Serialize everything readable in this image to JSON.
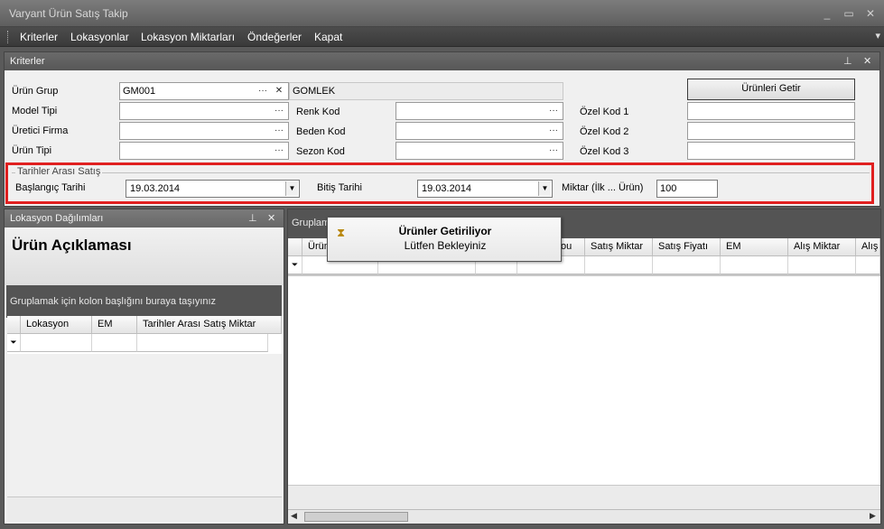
{
  "window": {
    "title": "Varyant Ürün Satış Takip",
    "minimize": "_",
    "maximize": "▭",
    "close": "✕"
  },
  "menu": [
    "Kriterler",
    "Lokasyonlar",
    "Lokasyon Miktarları",
    "Öndeğerler",
    "Kapat"
  ],
  "kriterler": {
    "title": "Kriterler",
    "pin": "⊥",
    "close": "✕",
    "urun_grup_label": "Ürün Grup",
    "urun_grup_value": "GM001",
    "urun_grup_desc": "GOMLEK",
    "model_tipi_label": "Model Tipi",
    "uretici_firma_label": "Üretici Firma",
    "urun_tipi_label": "Ürün Tipi",
    "renk_kod_label": "Renk Kod",
    "beden_kod_label": "Beden Kod",
    "sezon_kod_label": "Sezon Kod",
    "ozel_kod1_label": "Özel Kod 1",
    "ozel_kod2_label": "Özel Kod 2",
    "ozel_kod3_label": "Özel Kod 3",
    "urunleri_getir": "Ürünleri Getir",
    "ellipsis": "···",
    "clear": "✕"
  },
  "tarihler": {
    "legend": "Tarihler Arası Satış",
    "baslangic_label": "Başlangıç Tarihi",
    "baslangic_value": "19.03.2014",
    "bitis_label": "Bitiş Tarihi",
    "bitis_value": "19.03.2014",
    "miktar_label": "Miktar (İlk ... Ürün)",
    "miktar_value": "100"
  },
  "lokasyon": {
    "title": "Lokasyon Dağılımları",
    "pin": "⊥",
    "close": "✕",
    "urun_aciklamasi": "Ürün Açıklaması",
    "group_hint": "Gruplamak için kolon başlığını buraya taşıyınız",
    "columns": [
      "Lokasyon",
      "EM",
      "Tarihler Arası Satış Miktar"
    ]
  },
  "main_grid": {
    "group_hint": "Gruplam",
    "columns": [
      "Ürün",
      "",
      "",
      "ou",
      "Satış Miktar",
      "Satış Fiyatı",
      "EM",
      "Alış Miktar",
      "Alış F"
    ]
  },
  "popup": {
    "title": "Ürünler Getiriliyor",
    "message": "Lütfen Bekleyiniz"
  }
}
